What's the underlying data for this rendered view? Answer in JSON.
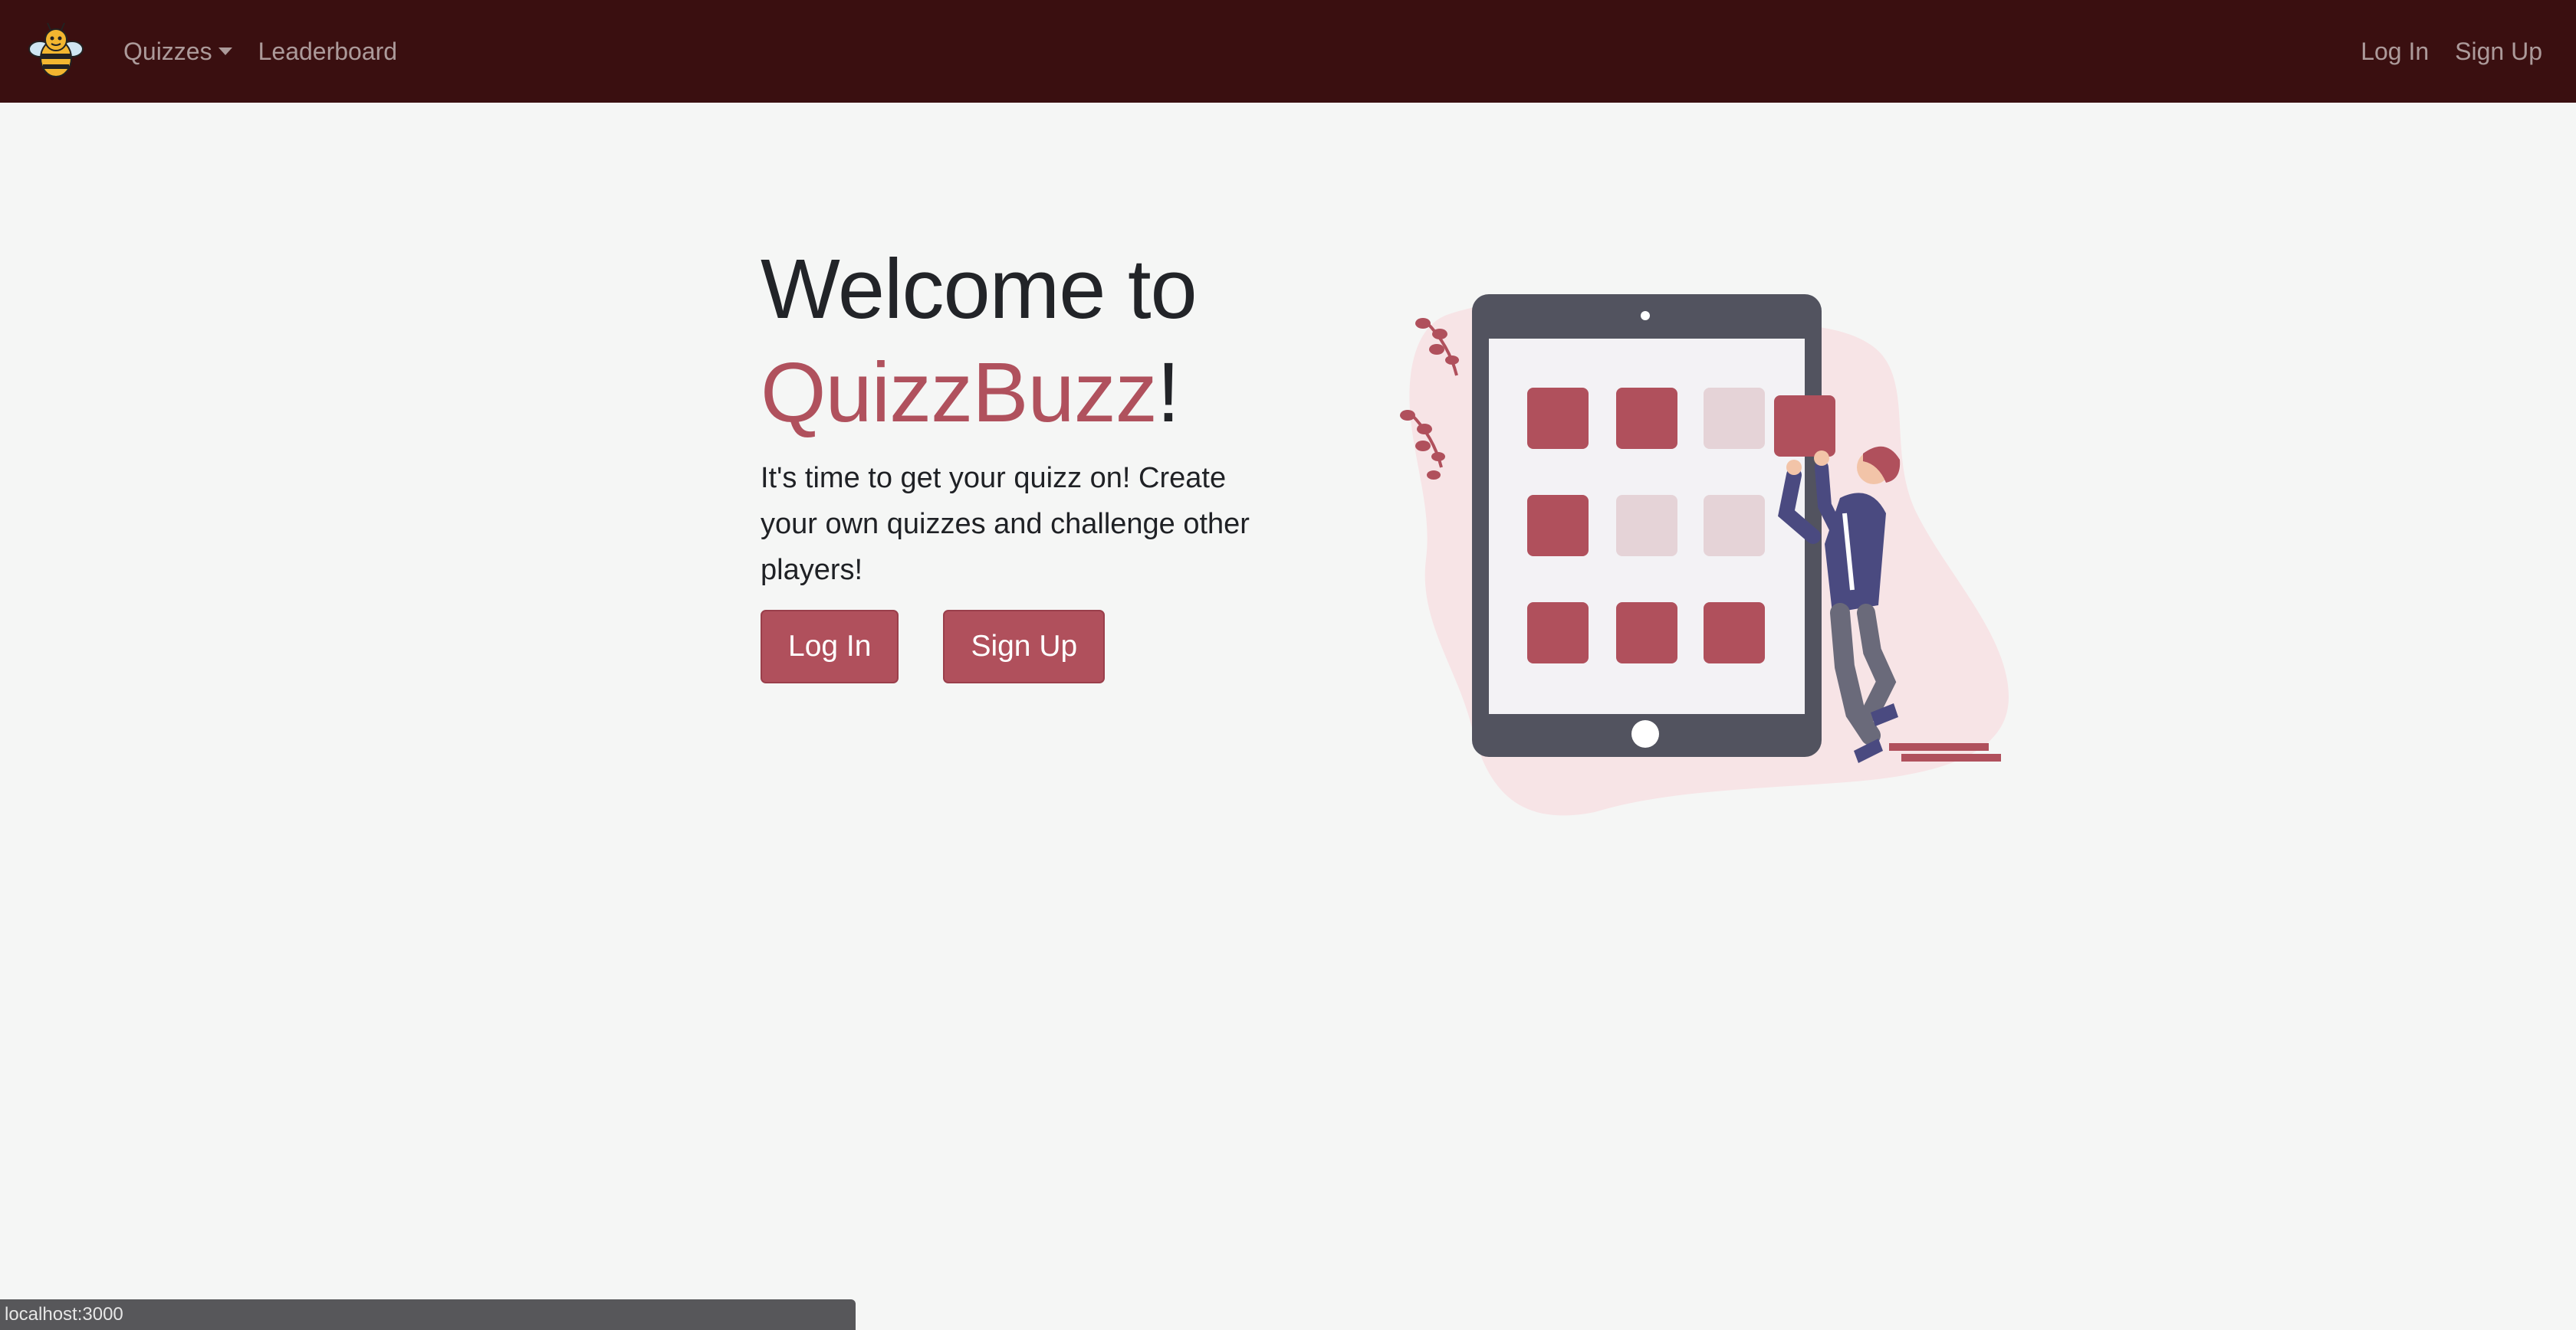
{
  "navbar": {
    "brand_icon": "bee-icon",
    "left_links": {
      "quizzes": "Quizzes",
      "leaderboard": "Leaderboard"
    },
    "right_links": {
      "login": "Log In",
      "signup": "Sign Up"
    }
  },
  "hero": {
    "title_line1": "Welcome to",
    "brand": "QuizzBuzz",
    "exclaim": "!",
    "description": "It's time to get your quizz on! Create your own quizzes and challenge other players!",
    "login_button": "Log In",
    "signup_button": "Sign Up"
  },
  "illustration": {
    "icon": "tablet-app-grid-illustration"
  },
  "status_bar": {
    "url": "localhost:3000"
  },
  "colors": {
    "navbar_bg": "#3a0f10",
    "accent": "#b0505c",
    "page_bg": "#f5f6f5"
  }
}
